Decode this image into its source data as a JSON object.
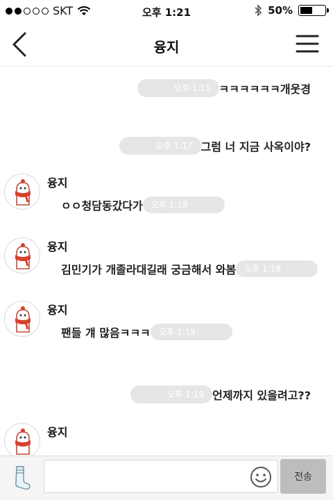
{
  "status_bar": {
    "carrier": "SKT",
    "time": "오후 1:21",
    "battery_percent": "50%",
    "battery_level": 0.5
  },
  "header": {
    "title": "융지"
  },
  "messages": [
    {
      "type": "sent",
      "time": "오후 1:15",
      "text": "ㅋㅋㅋㅋㅋㅋ개웃경"
    },
    {
      "type": "sent",
      "time": "오후 1:17",
      "text": "그럼 너 지금 사옥이야?"
    },
    {
      "type": "received",
      "name": "융지",
      "time": "오후 1:18",
      "text": "ㅇㅇ청담동갔다가"
    },
    {
      "type": "received",
      "name": "융지",
      "time": "오후 1:18",
      "text": "김민기가 개졸라대길래 궁금해서 와봄"
    },
    {
      "type": "received",
      "name": "융지",
      "time": "오후 1:19",
      "text": "팬들 걔 많음ㅋㅋㅋ"
    },
    {
      "type": "sent",
      "time": "오후 1:19",
      "text": "언제까지 있을려고??"
    },
    {
      "type": "received",
      "name": "융지",
      "time": "",
      "text": ""
    }
  ],
  "input_bar": {
    "placeholder": "",
    "send_label": "전송"
  },
  "icons": {
    "back": "chevron-left-icon",
    "menu": "hamburger-menu-icon",
    "attach": "sock-icon",
    "emoji": "smiley-icon",
    "avatar": "mitten-character-icon"
  }
}
